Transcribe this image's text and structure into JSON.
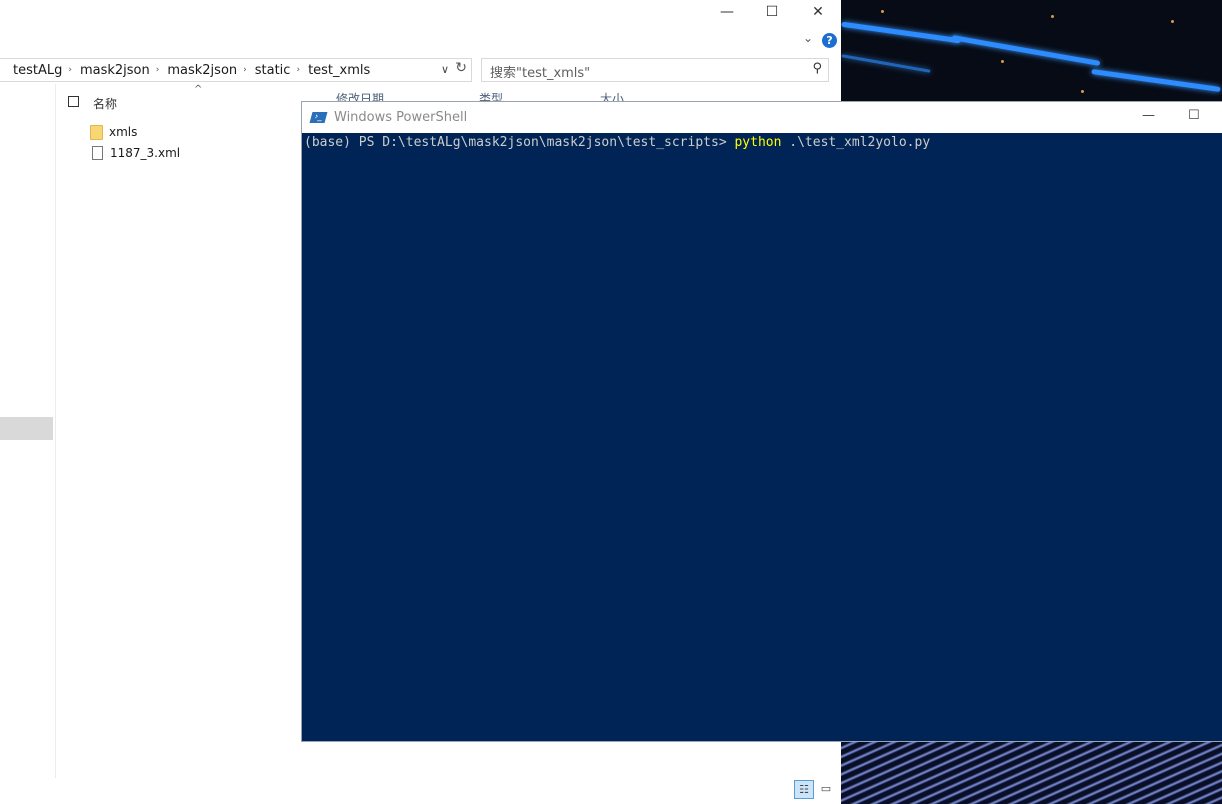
{
  "explorer": {
    "window_controls": {
      "minimize": "—",
      "maximize": "☐",
      "close": "✕"
    },
    "breadcrumb": [
      "testALg",
      "mask2json",
      "mask2json",
      "static",
      "test_xmls"
    ],
    "search_placeholder": "搜索\"test_xmls\"",
    "columns": {
      "name": "名称",
      "modified": "修改日期",
      "type": "类型",
      "size": "大小"
    },
    "files": [
      {
        "name": "xmls",
        "kind": "folder"
      },
      {
        "name": "1187_3.xml",
        "kind": "file"
      }
    ]
  },
  "powershell": {
    "title": "Windows PowerShell",
    "prompt": "(base) PS D:\\testALg\\mask2json\\mask2json\\test_scripts> ",
    "command": "python",
    "args": " .\\test_xml2yolo.py",
    "colors": {
      "background": "#012456",
      "command": "#ffff00"
    }
  }
}
